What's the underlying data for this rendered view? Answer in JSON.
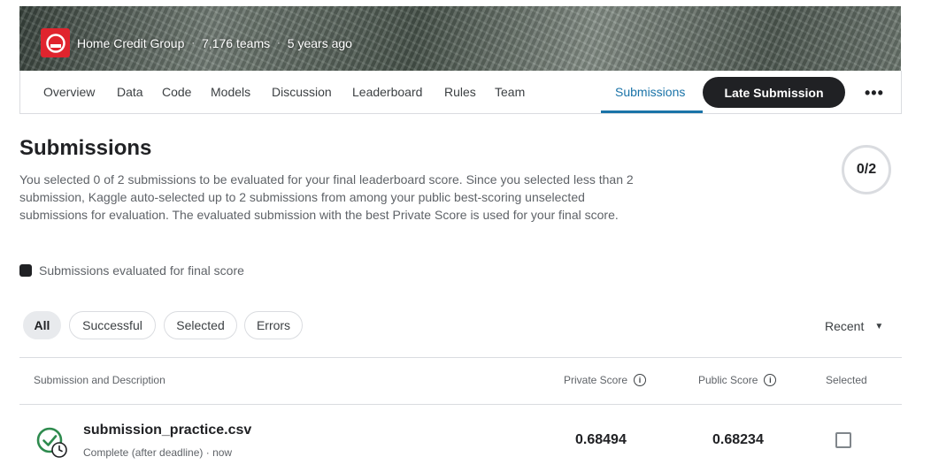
{
  "competition": {
    "organization": "Home Credit Group",
    "teams": "7,176 teams",
    "age": "5 years ago",
    "separator": "·"
  },
  "tabs": [
    {
      "label": "Overview"
    },
    {
      "label": "Data"
    },
    {
      "label": "Code"
    },
    {
      "label": "Models"
    },
    {
      "label": "Discussion"
    },
    {
      "label": "Leaderboard"
    },
    {
      "label": "Rules"
    },
    {
      "label": "Team"
    },
    {
      "label": "Submissions",
      "active": true
    }
  ],
  "late_submission_label": "Late Submission",
  "more_label": "•••",
  "page": {
    "title": "Submissions",
    "description": "You selected 0 of 2 submissions to be evaluated for your final leaderboard score. Since you selected less than 2 submission, Kaggle auto-selected up to 2 submissions from among your public best-scoring unselected submissions for evaluation. The evaluated submission with the best Private Score is used for your final score.",
    "counter": "0/2",
    "legend": "Submissions evaluated for final score"
  },
  "filters": [
    {
      "label": "All",
      "active": true
    },
    {
      "label": "Successful"
    },
    {
      "label": "Selected"
    },
    {
      "label": "Errors"
    }
  ],
  "sort": {
    "label": "Recent",
    "caret": "▼"
  },
  "table": {
    "headers": {
      "submission": "Submission and Description",
      "private": "Private Score",
      "public": "Public Score",
      "selected": "Selected",
      "info_glyph": "i"
    },
    "rows": [
      {
        "file": "submission_practice.csv",
        "status": "Complete (after deadline) · now",
        "private_score": "0.68494",
        "public_score": "0.68234",
        "selected": false
      }
    ]
  },
  "colors": {
    "accent": "#1a73a8",
    "brand_red": "#e0242e",
    "success_green": "#2e8b4e",
    "dark": "#202124"
  }
}
